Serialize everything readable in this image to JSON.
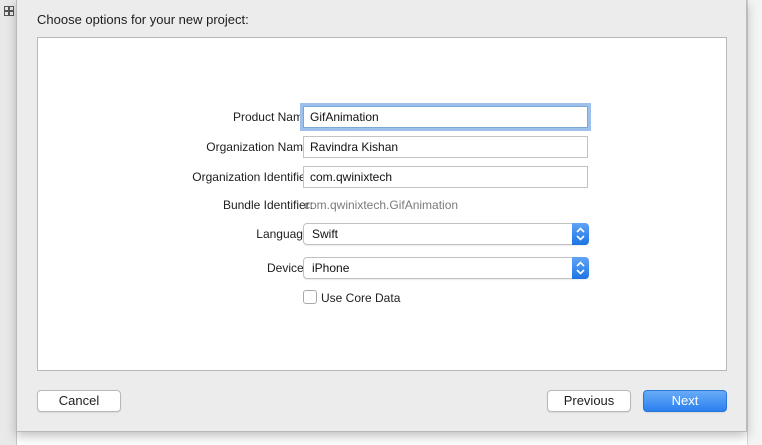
{
  "dialog": {
    "title": "Choose options for your new project:"
  },
  "form": {
    "product_name": {
      "label": "Product Name:",
      "value": "GifAnimation"
    },
    "organization_name": {
      "label": "Organization Name:",
      "value": "Ravindra Kishan"
    },
    "organization_identifier": {
      "label": "Organization Identifier:",
      "value": "com.qwinixtech"
    },
    "bundle_identifier": {
      "label": "Bundle Identifier:",
      "value": "com.qwinixtech.GifAnimation"
    },
    "language": {
      "label": "Language:",
      "selected": "Swift"
    },
    "devices": {
      "label": "Devices:",
      "selected": "iPhone"
    },
    "use_core_data": {
      "label": "Use Core Data",
      "checked": false
    }
  },
  "buttons": {
    "cancel": "Cancel",
    "previous": "Previous",
    "next": "Next"
  },
  "colors": {
    "accent": "#2b80ee",
    "focus_ring": "#9dc1ec",
    "sheet_background": "#ececec"
  },
  "icons": {
    "stepper": "updown-chevron-icon",
    "checkbox": "checkbox-unchecked-icon",
    "corner": "window-grid-icon"
  }
}
